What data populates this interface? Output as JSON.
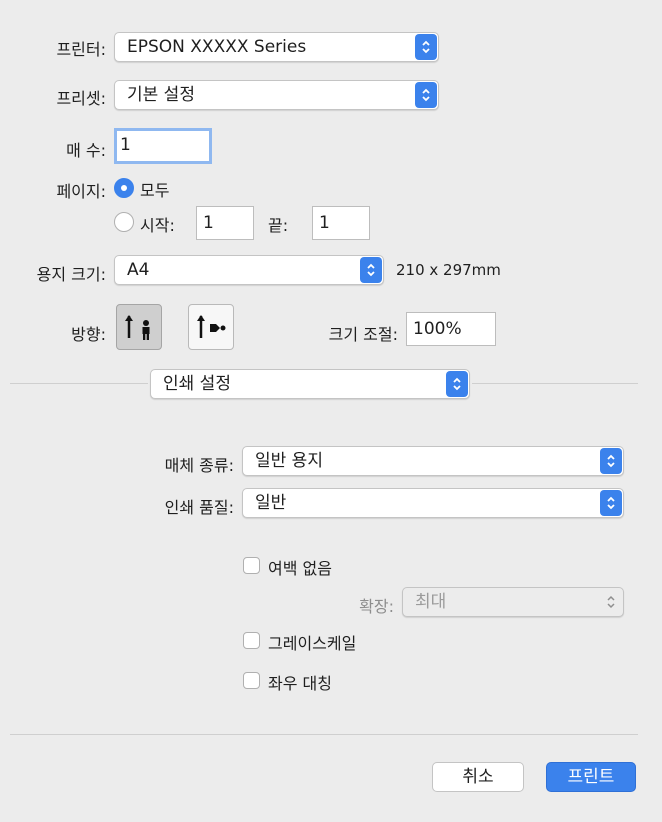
{
  "printer": {
    "label": "프린터:",
    "value": "EPSON XXXXX Series"
  },
  "preset": {
    "label": "프리셋:",
    "value": "기본 설정"
  },
  "copies": {
    "label": "매 수:",
    "value": "1"
  },
  "pages": {
    "label": "페이지:",
    "all_label": "모두",
    "from_label": "시작:",
    "from_value": "1",
    "to_label": "끝:",
    "to_value": "1",
    "selected": "all"
  },
  "paper_size": {
    "label": "용지 크기:",
    "value": "A4",
    "dimensions": "210 x 297mm"
  },
  "orientation": {
    "label": "방향:",
    "selected": "portrait"
  },
  "scale": {
    "label": "크기 조절:",
    "value": "100%"
  },
  "section": {
    "value": "인쇄 설정"
  },
  "media_type": {
    "label": "매체 종류:",
    "value": "일반 용지"
  },
  "print_quality": {
    "label": "인쇄 품질:",
    "value": "일반"
  },
  "borderless": {
    "label": "여백 없음",
    "checked": false
  },
  "expansion": {
    "label": "확장:",
    "value": "최대",
    "enabled": false
  },
  "grayscale": {
    "label": "그레이스케일",
    "checked": false
  },
  "mirror": {
    "label": "좌우 대칭",
    "checked": false
  },
  "actions": {
    "cancel": "취소",
    "print": "프린트"
  },
  "colors": {
    "accent": "#3b82ec",
    "background": "#ececec"
  }
}
